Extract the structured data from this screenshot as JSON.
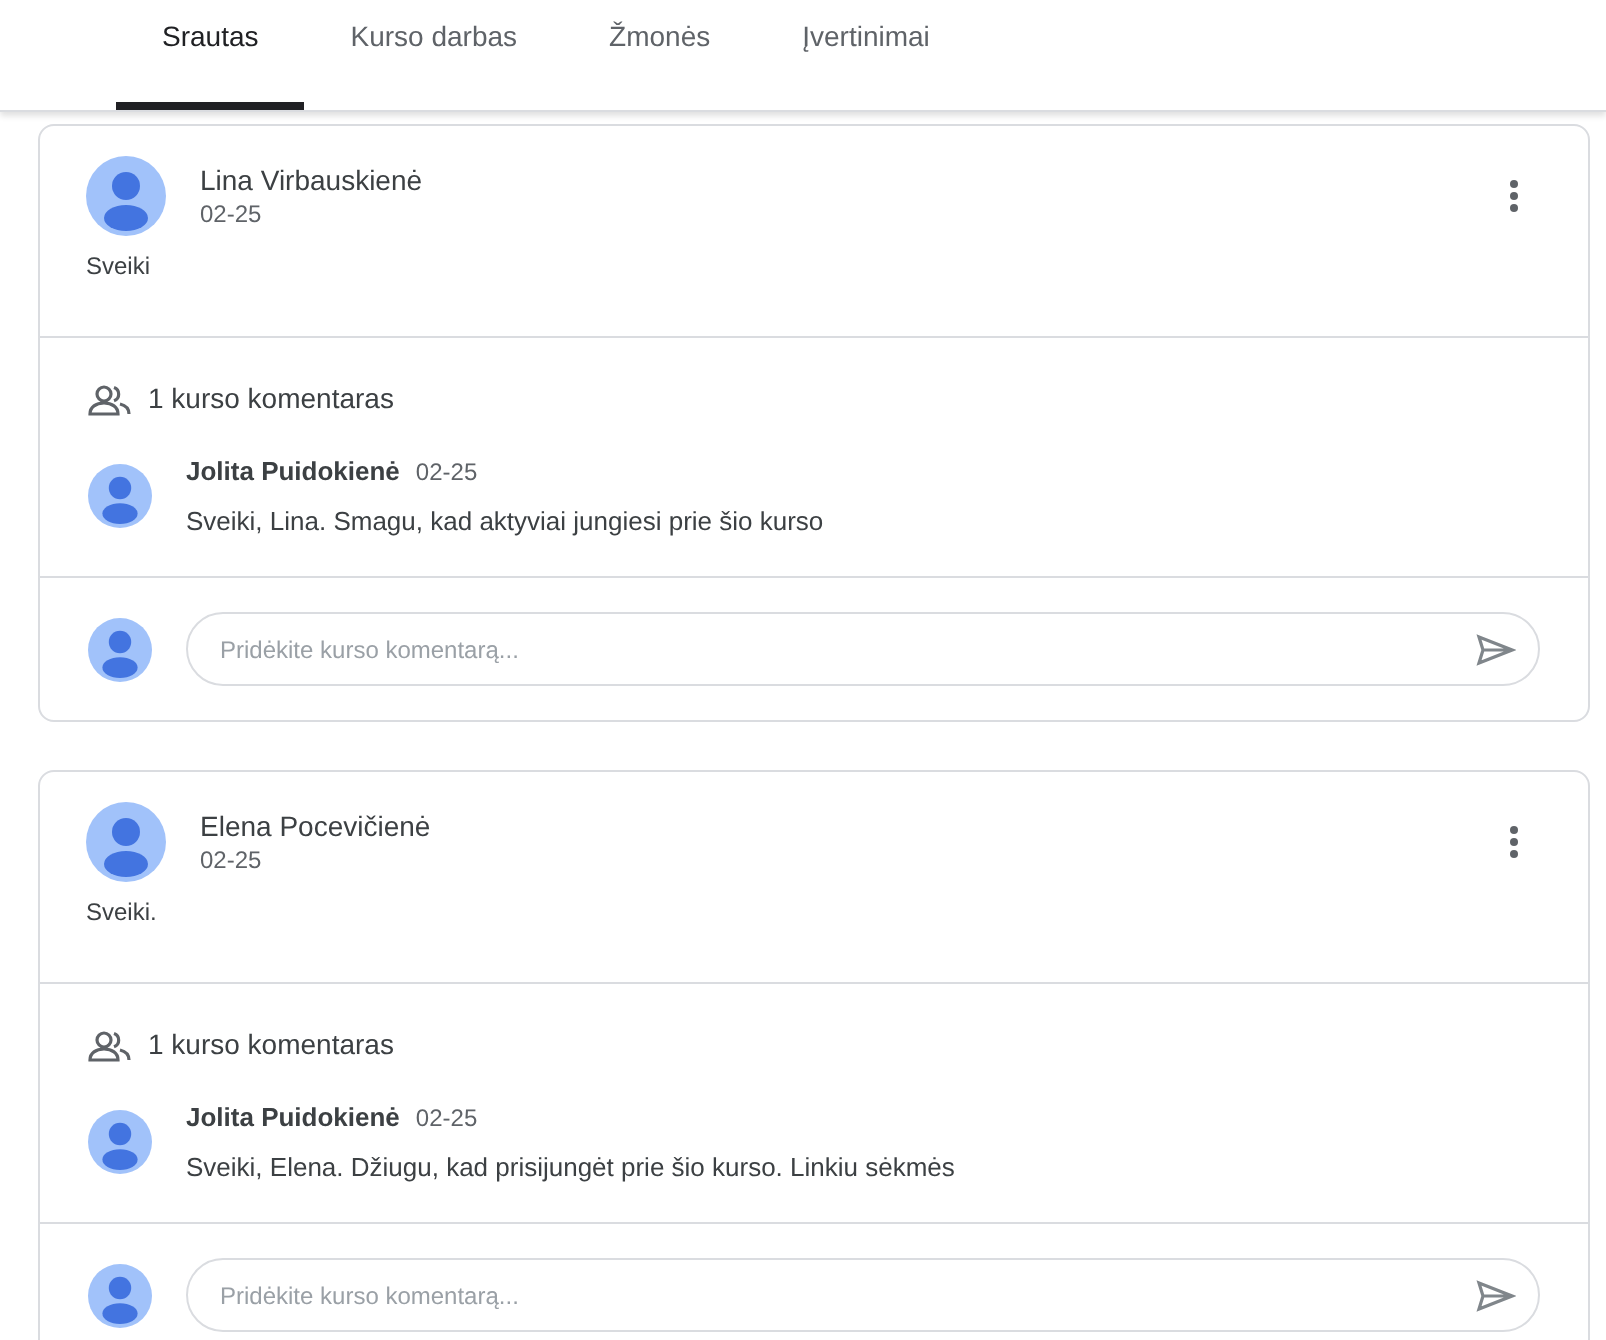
{
  "tabs": [
    {
      "label": "Srautas",
      "selected": true
    },
    {
      "label": "Kurso darbas",
      "selected": false
    },
    {
      "label": "Žmonės",
      "selected": false
    },
    {
      "label": "Įvertinimai",
      "selected": false
    }
  ],
  "posts": [
    {
      "author": "Lina Virbauskienė",
      "date": "02-25",
      "text": "Sveiki",
      "comment_count": "1 kurso komentaras",
      "comments": [
        {
          "author": "Jolita Puidokienė",
          "date": "02-25",
          "text": "Sveiki, Lina. Smagu, kad aktyviai jungiesi prie šio kurso"
        }
      ],
      "reply": {
        "placeholder": "Pridėkite kurso komentarą..."
      }
    },
    {
      "author": "Elena Pocevičienė",
      "date": "02-25",
      "text": "Sveiki.",
      "comment_count": "1 kurso komentaras",
      "comments": [
        {
          "author": "Jolita Puidokienė",
          "date": "02-25",
          "text": "Sveiki, Elena. Džiugu, kad prisijungėt prie šio kurso. Linkiu sėkmės"
        }
      ],
      "reply": {
        "placeholder": "Pridėkite kurso komentarą..."
      }
    }
  ]
}
